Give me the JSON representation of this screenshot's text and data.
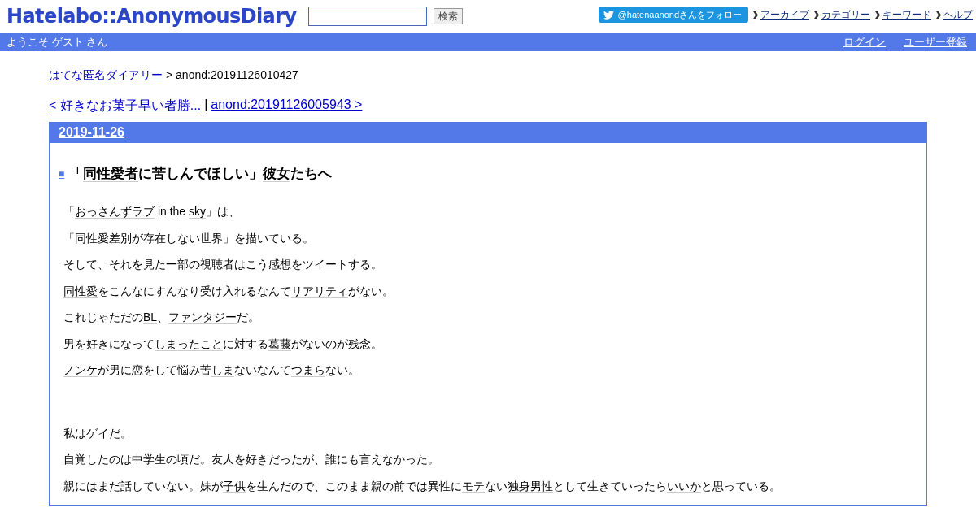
{
  "header": {
    "logo": "Hatelabo::AnonymousDiary",
    "search": {
      "button": "検索"
    },
    "twitter_follow": "@hatenaanondさんをフォロー",
    "nav": [
      "アーカイブ",
      "カテゴリー",
      "キーワード",
      "ヘルプ"
    ]
  },
  "user_bar": {
    "welcome": "ようこそ ゲスト さん",
    "links": [
      "ログイン",
      "ユーザー登録"
    ]
  },
  "breadcrumb": {
    "link": "はてな匿名ダイアリー",
    "current": "> anond:20191126010427"
  },
  "pager": {
    "prev": "< 好きなお菓子早い者勝...",
    "separator": "|",
    "next": "anond:20191126005943 >"
  },
  "day": {
    "date": "2019-11-26",
    "section": {
      "mark": "■",
      "title": [
        {
          "text": "「",
          "keyword": false
        },
        {
          "text": "同性愛者",
          "keyword": true
        },
        {
          "text": "に苦しんでほしい」",
          "keyword": false
        },
        {
          "text": "彼女",
          "keyword": true
        },
        {
          "text": "たちへ",
          "keyword": false
        }
      ],
      "paragraphs": [
        [
          {
            "text": "「",
            "keyword": false
          },
          {
            "text": "おっさんずラブ",
            "keyword": true
          },
          {
            "text": " in the ",
            "keyword": false
          },
          {
            "text": "sky",
            "keyword": true
          },
          {
            "text": "」は、",
            "keyword": false
          }
        ],
        [
          {
            "text": "「",
            "keyword": false
          },
          {
            "text": "同性愛差別",
            "keyword": true
          },
          {
            "text": "が",
            "keyword": false
          },
          {
            "text": "存在",
            "keyword": true
          },
          {
            "text": "しない",
            "keyword": false
          },
          {
            "text": "世界",
            "keyword": true
          },
          {
            "text": "」を描いている。",
            "keyword": false
          }
        ],
        [
          {
            "text": "そして、それを見た一部の",
            "keyword": false
          },
          {
            "text": "視聴者",
            "keyword": true
          },
          {
            "text": "はこう",
            "keyword": false
          },
          {
            "text": "感想",
            "keyword": true
          },
          {
            "text": "を",
            "keyword": false
          },
          {
            "text": "ツイート",
            "keyword": true
          },
          {
            "text": "する。",
            "keyword": false
          }
        ],
        [
          {
            "text": "同性愛",
            "keyword": true
          },
          {
            "text": "をこんなにすんなり受け入れるなんて",
            "keyword": false
          },
          {
            "text": "リアリティ",
            "keyword": true
          },
          {
            "text": "がない。",
            "keyword": false
          }
        ],
        [
          {
            "text": "これじゃただの",
            "keyword": false
          },
          {
            "text": "BL",
            "keyword": true
          },
          {
            "text": "、",
            "keyword": false
          },
          {
            "text": "ファンタジー",
            "keyword": true
          },
          {
            "text": "だ。",
            "keyword": false
          }
        ],
        [
          {
            "text": "男を好きになって",
            "keyword": false
          },
          {
            "text": "しまったこと",
            "keyword": true
          },
          {
            "text": "に対する",
            "keyword": false
          },
          {
            "text": "葛藤",
            "keyword": true
          },
          {
            "text": "がないのが残念。",
            "keyword": false
          }
        ],
        [
          {
            "text": "ノンケ",
            "keyword": true
          },
          {
            "text": "が男に恋をして悩み苦",
            "keyword": false
          },
          {
            "text": "しま",
            "keyword": true
          },
          {
            "text": "ないなんて",
            "keyword": false
          },
          {
            "text": "つまら",
            "keyword": true
          },
          {
            "text": "ない。",
            "keyword": false
          }
        ],
        [
          {
            "text": "私は",
            "keyword": false
          },
          {
            "text": "ゲイ",
            "keyword": true
          },
          {
            "text": "だ。",
            "keyword": false
          }
        ],
        [
          {
            "text": "自覚",
            "keyword": true
          },
          {
            "text": "したのは",
            "keyword": false
          },
          {
            "text": "中学生",
            "keyword": true
          },
          {
            "text": "の頃だ。友人を好きだったが、誰にも言えなかった。",
            "keyword": false
          }
        ],
        [
          {
            "text": "親にはまだ話していない。妹が",
            "keyword": false
          },
          {
            "text": "子供",
            "keyword": true
          },
          {
            "text": "を生んだので、このまま親の前では異性に",
            "keyword": false
          },
          {
            "text": "モテ",
            "keyword": true
          },
          {
            "text": "ない",
            "keyword": false
          },
          {
            "text": "独身男性",
            "keyword": true
          },
          {
            "text": "として生きていったら",
            "keyword": false
          },
          {
            "text": "いいか",
            "keyword": true
          },
          {
            "text": "と思っている。",
            "keyword": false
          }
        ]
      ]
    }
  }
}
